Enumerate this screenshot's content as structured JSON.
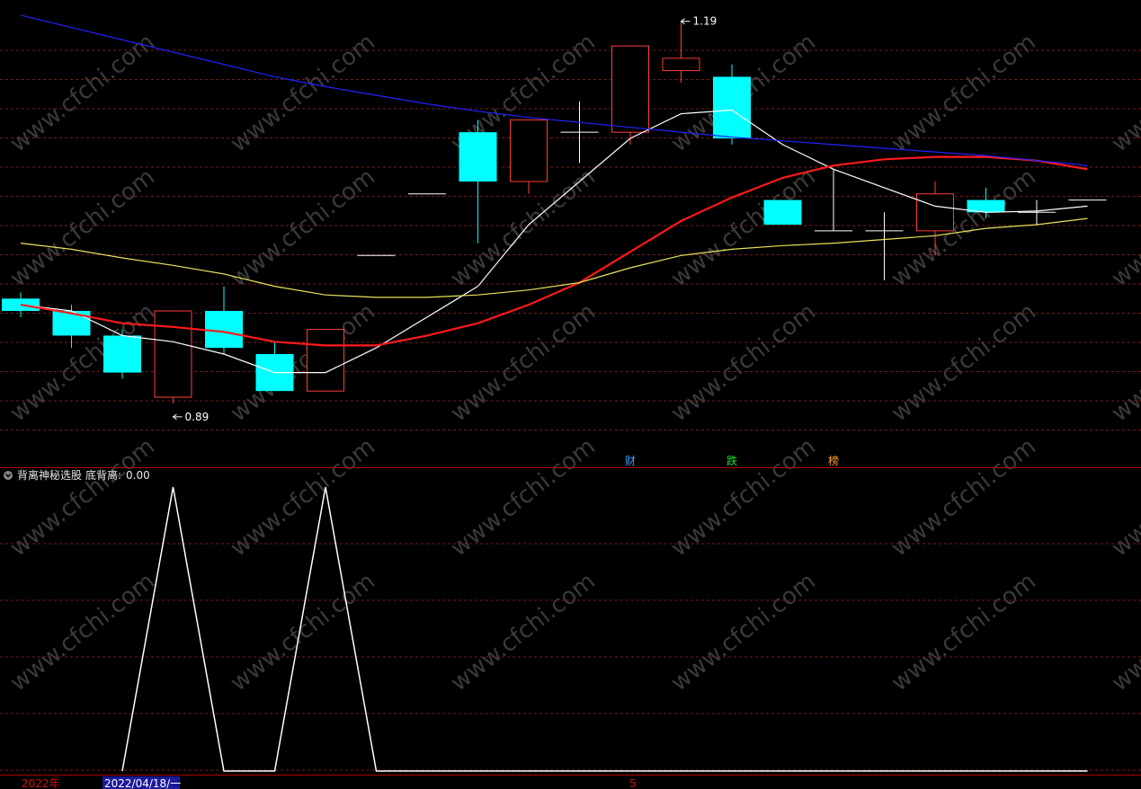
{
  "colors": {
    "background": "#000000",
    "grid": "#7a1a1a",
    "separator": "#b00000",
    "up": "#ff3c3c",
    "down": "#00ffff",
    "doji": "#ffffff",
    "ma_fast": "#ffffff",
    "ma_mid": "#ff1a1a",
    "ma_slow": "#e8e35a",
    "trend": "#2222ff",
    "indicator": "#ffffff",
    "watermark": "#3a3a3a"
  },
  "watermark": "www.cfchi.com",
  "markers": [
    {
      "index": 12,
      "text": "财",
      "color": "#3aa0ff"
    },
    {
      "index": 14,
      "text": "跌",
      "color": "#22dd22"
    },
    {
      "index": 16,
      "text": "榜",
      "color": "#ff9a2a"
    }
  ],
  "indicator": {
    "title": "背离神秘选股",
    "value_label": "底背离:",
    "value": "0.00"
  },
  "footer": {
    "year": "2022年",
    "date": "2022/04/18/一",
    "month": "5"
  },
  "chart_data": [
    {
      "type": "candlestick",
      "ylim": [
        0.85,
        1.2
      ],
      "candles": [
        {
          "open": 0.965,
          "high": 0.97,
          "low": 0.95,
          "close": 0.955
        },
        {
          "open": 0.955,
          "high": 0.96,
          "low": 0.925,
          "close": 0.935
        },
        {
          "open": 0.935,
          "high": 0.94,
          "low": 0.9,
          "close": 0.905
        },
        {
          "open": 0.885,
          "high": 0.955,
          "low": 0.88,
          "close": 0.955
        },
        {
          "open": 0.955,
          "high": 0.975,
          "low": 0.92,
          "close": 0.925
        },
        {
          "open": 0.92,
          "high": 0.93,
          "low": 0.89,
          "close": 0.89
        },
        {
          "open": 0.89,
          "high": 0.94,
          "low": 0.89,
          "close": 0.94
        },
        {
          "open": 1.0,
          "high": 1.0,
          "low": 1.0,
          "close": 1.0
        },
        {
          "open": 1.05,
          "high": 1.05,
          "low": 1.05,
          "close": 1.05
        },
        {
          "open": 1.1,
          "high": 1.11,
          "low": 1.01,
          "close": 1.06
        },
        {
          "open": 1.06,
          "high": 1.11,
          "low": 1.05,
          "close": 1.11
        },
        {
          "open": 1.1,
          "high": 1.125,
          "low": 1.075,
          "close": 1.1
        },
        {
          "open": 1.1,
          "high": 1.17,
          "low": 1.09,
          "close": 1.17
        },
        {
          "open": 1.15,
          "high": 1.19,
          "low": 1.14,
          "close": 1.16
        },
        {
          "open": 1.145,
          "high": 1.155,
          "low": 1.09,
          "close": 1.095
        },
        {
          "open": 1.045,
          "high": 1.045,
          "low": 1.025,
          "close": 1.025
        },
        {
          "open": 1.02,
          "high": 1.07,
          "low": 1.02,
          "close": 1.02
        },
        {
          "open": 1.02,
          "high": 1.035,
          "low": 0.98,
          "close": 1.02
        },
        {
          "open": 1.02,
          "high": 1.06,
          "low": 1.0,
          "close": 1.05
        },
        {
          "open": 1.045,
          "high": 1.055,
          "low": 1.03,
          "close": 1.035
        },
        {
          "open": 1.035,
          "high": 1.045,
          "low": 1.025,
          "close": 1.035
        },
        {
          "open": 1.045,
          "high": 1.045,
          "low": 1.045,
          "close": 1.045
        }
      ],
      "high_label": {
        "index": 13,
        "value": "1.19"
      },
      "low_label": {
        "index": 3,
        "value": "0.89"
      },
      "series": [
        {
          "key": "ma_fast",
          "values": [
            0.96,
            0.955,
            0.935,
            0.93,
            0.92,
            0.905,
            0.905,
            0.925,
            0.95,
            0.975,
            1.025,
            1.06,
            1.095,
            1.115,
            1.118,
            1.09,
            1.07,
            1.055,
            1.04,
            1.035,
            1.036,
            1.04
          ]
        },
        {
          "key": "ma_mid",
          "values": [
            0.96,
            0.953,
            0.945,
            0.942,
            0.938,
            0.93,
            0.927,
            0.927,
            0.935,
            0.945,
            0.96,
            0.978,
            1.003,
            1.028,
            1.047,
            1.063,
            1.073,
            1.078,
            1.08,
            1.08,
            1.077,
            1.07
          ]
        },
        {
          "key": "ma_slow",
          "values": [
            1.01,
            1.005,
            0.998,
            0.992,
            0.985,
            0.975,
            0.968,
            0.966,
            0.966,
            0.968,
            0.972,
            0.978,
            0.99,
            1.0,
            1.005,
            1.008,
            1.01,
            1.013,
            1.016,
            1.022,
            1.025,
            1.03
          ]
        },
        {
          "key": "trend",
          "values": [
            1.195,
            1.185,
            1.175,
            1.165,
            1.155,
            1.145,
            1.137,
            1.13,
            1.123,
            1.117,
            1.112,
            1.108,
            1.104,
            1.1,
            1.096,
            1.093,
            1.09,
            1.087,
            1.084,
            1.081,
            1.077,
            1.073
          ]
        }
      ]
    },
    {
      "type": "line",
      "ylim": [
        0,
        1
      ],
      "values": [
        0,
        0,
        0,
        1,
        0,
        0,
        1,
        0,
        0,
        0,
        0,
        0,
        0,
        0,
        0,
        0,
        0,
        0,
        0,
        0,
        0,
        0
      ]
    }
  ]
}
